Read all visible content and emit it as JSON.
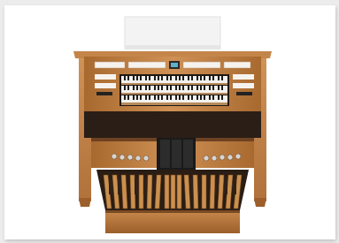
{
  "image": {
    "subject": "",
    "colors": {
      "background": "#ececec",
      "card": "#ffffff",
      "wood_light": "#c98a4e",
      "wood_mid": "#b2743a",
      "wood_dark": "#8a5326",
      "key_white": "#f4f2ee",
      "key_black": "#1c1c1c",
      "interior_dark": "#241a14"
    }
  }
}
